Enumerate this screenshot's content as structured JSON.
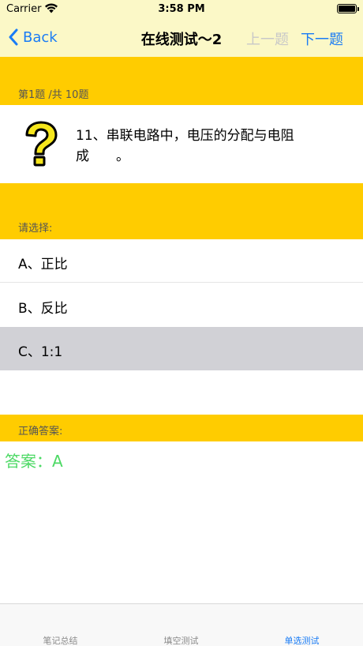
{
  "status_bar": {
    "carrier": "Carrier",
    "time": "3:58 PM"
  },
  "nav": {
    "back_label": "Back",
    "title": "在线测试～2",
    "prev_label": "上一题",
    "next_label": "下一题"
  },
  "question": {
    "count_label": "第1题 /共 10题",
    "text": "11、串联电路中，电压的分配与电阻成　　。",
    "icon": "question-mark-icon"
  },
  "choose_label": "请选择:",
  "options": [
    {
      "label": "A、正比"
    },
    {
      "label": "B、反比"
    },
    {
      "label": "C、1:1"
    }
  ],
  "answer": {
    "header_label": "正确答案:",
    "text": "答案：A"
  },
  "tabs": [
    {
      "label": "笔记总结"
    },
    {
      "label": "填空测试"
    },
    {
      "label": "单选测试"
    }
  ],
  "colors": {
    "accent": "#1a7cf5",
    "section": "#ffcc00",
    "top_bg": "#fbf8c7",
    "answer": "#4cd964",
    "selected": "#d1d1d6"
  }
}
